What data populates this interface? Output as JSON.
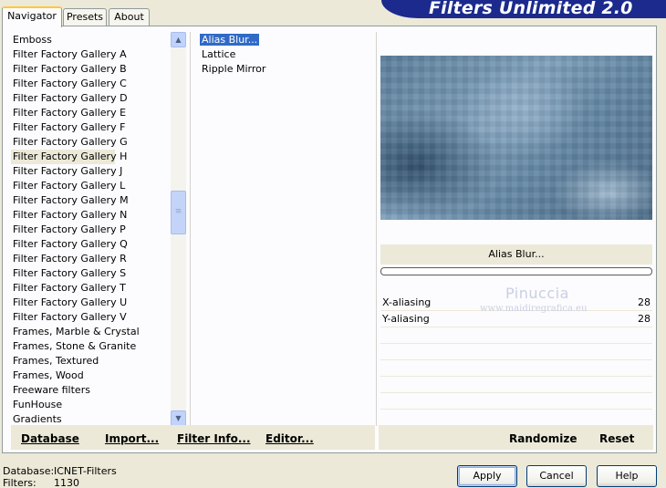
{
  "tabs": [
    {
      "label": "Navigator",
      "active": true
    },
    {
      "label": "Presets",
      "active": false
    },
    {
      "label": "About",
      "active": false
    }
  ],
  "banner": {
    "title": "Filters Unlimited 2.0"
  },
  "categories": {
    "items": [
      "Emboss",
      "Filter Factory Gallery A",
      "Filter Factory Gallery B",
      "Filter Factory Gallery C",
      "Filter Factory Gallery D",
      "Filter Factory Gallery E",
      "Filter Factory Gallery F",
      "Filter Factory Gallery G",
      "Filter Factory Gallery H",
      "Filter Factory Gallery J",
      "Filter Factory Gallery L",
      "Filter Factory Gallery M",
      "Filter Factory Gallery N",
      "Filter Factory Gallery P",
      "Filter Factory Gallery Q",
      "Filter Factory Gallery R",
      "Filter Factory Gallery S",
      "Filter Factory Gallery T",
      "Filter Factory Gallery U",
      "Filter Factory Gallery V",
      "Frames, Marble & Crystal",
      "Frames, Stone & Granite",
      "Frames, Textured",
      "Frames, Wood",
      "Freeware filters",
      "FunHouse",
      "Gradients"
    ],
    "selected": "Filter Factory Gallery H"
  },
  "filters": {
    "items": [
      "Alias Blur...",
      "Lattice",
      "Ripple Mirror"
    ],
    "selected": "Alias Blur..."
  },
  "toolbar": {
    "database": "Database",
    "import": "Import...",
    "filter_info": "Filter Info...",
    "editor": "Editor...",
    "randomize": "Randomize",
    "reset": "Reset"
  },
  "preview": {
    "filter_name": "Alias Blur...",
    "params": [
      {
        "name": "X-aliasing",
        "value": "28"
      },
      {
        "name": "Y-aliasing",
        "value": "28"
      }
    ]
  },
  "watermark": {
    "name": "Pinuccia",
    "site": "www.maidiregrafica.eu"
  },
  "status": {
    "database_label": "Database:",
    "database_value": "ICNET-Filters",
    "filters_label": "Filters:",
    "filters_value": "1130"
  },
  "buttons": {
    "apply": "Apply",
    "cancel": "Cancel",
    "help": "Help"
  },
  "colors": {
    "banner": "#1b2a8c",
    "selection": "#316ac5",
    "tab_highlight": "#ffc83c"
  }
}
